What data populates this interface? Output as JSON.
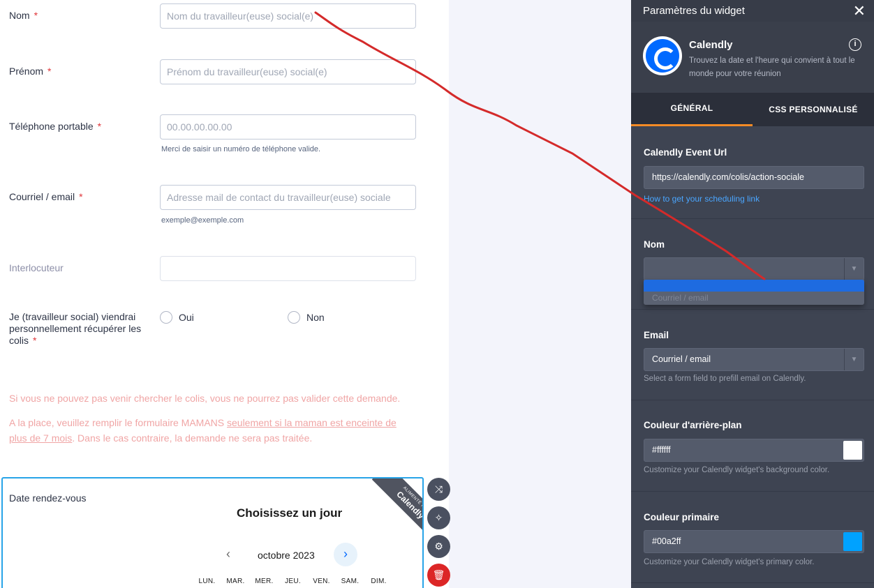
{
  "form": {
    "nom": {
      "label": "Nom",
      "req": "*",
      "placeholder": "Nom du travailleur(euse) social(e)"
    },
    "prenom": {
      "label": "Prénom",
      "req": "*",
      "placeholder": "Prénom du travailleur(euse) social(e)"
    },
    "telephone": {
      "label": "Téléphone portable",
      "req": "*",
      "placeholder": "00.00.00.00.00",
      "sublabel": "Merci de saisir un numéro de téléphone valide."
    },
    "email": {
      "label": "Courriel / email",
      "req": "*",
      "placeholder": "Adresse mail de contact du travailleur(euse) sociale",
      "sublabel": "exemple@exemple.com"
    },
    "interlocuteur": {
      "label": "Interlocuteur",
      "value": ""
    },
    "collect": {
      "label": "Je (travailleur social) viendrai personnellement récupérer les colis",
      "req": "*",
      "option_yes": "Oui",
      "option_no": "Non"
    },
    "notice1": "Si vous ne pouvez pas venir chercher le colis, vous ne pourrez pas valider cette demande.",
    "notice2_a": "A la place, veuillez remplir le formulaire MAMANS ",
    "notice2_link": "seulement si la maman est enceinte de plus de 7 mois",
    "notice2_b": ". Dans le cas contraire, la demande ne sera pas traitée."
  },
  "calendly_embed": {
    "label": "Date rendez-vous",
    "title": "Choisissez un jour",
    "month": "octobre 2023",
    "prev": "‹",
    "next": "›",
    "days": [
      "LUN.",
      "MAR.",
      "MER.",
      "JEU.",
      "VEN.",
      "SAM.",
      "DIM."
    ],
    "ribbon_small": "ALIMENTÉ PAR",
    "ribbon_big": "Calendly"
  },
  "tools": {
    "shuffle": "⤨",
    "wand": "✧",
    "settings": "⚙",
    "delete": "🗑"
  },
  "panel": {
    "title": "Paramètres du widget",
    "close": "✕",
    "widget_name": "Calendly",
    "widget_desc": "Trouvez la date et l'heure qui convient à tout le monde pour votre réunion",
    "info": "i",
    "tabs": [
      "GÉNÉRAL",
      "CSS PERSONNALISÉ"
    ],
    "event_url": {
      "title": "Calendly Event Url",
      "value": "https://calendly.com/colis/action-sociale",
      "link": "How to get your scheduling link"
    },
    "nom": {
      "title": "Nom",
      "value": "",
      "dropdown_option": "Courriel / email"
    },
    "email": {
      "title": "Email",
      "value": "Courriel / email",
      "help": "Select a form field to prefill email on Calendly."
    },
    "bg_color": {
      "title": "Couleur d'arrière-plan",
      "value": "#ffffff",
      "help": "Customize your Calendly widget's background color.",
      "swatch": "#ffffff"
    },
    "primary_color": {
      "title": "Couleur primaire",
      "value": "#00a2ff",
      "help": "Customize your Calendly widget's primary color.",
      "swatch": "#00a2ff"
    },
    "select_arrow": "▼"
  },
  "colors": {
    "accent_tab": "#f58b25",
    "link": "#4aa6ff",
    "annotation": "#d42a2a",
    "required": "#e0363a"
  }
}
